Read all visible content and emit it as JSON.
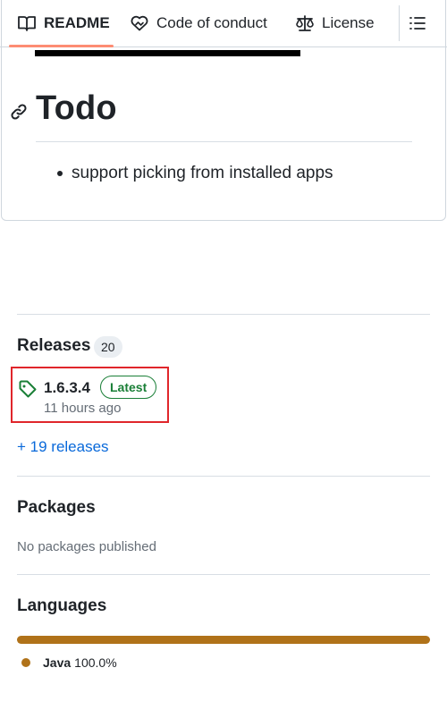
{
  "tabs": {
    "readme": "README",
    "conduct": "Code of conduct",
    "license": "License"
  },
  "readme": {
    "heading": "Todo",
    "items": [
      "support picking from installed apps"
    ]
  },
  "releases": {
    "title": "Releases",
    "count": "20",
    "latest": {
      "version": "1.6.3.4",
      "badge": "Latest",
      "time": "11 hours ago"
    },
    "more_link": "+ 19 releases"
  },
  "packages": {
    "title": "Packages",
    "empty_text": "No packages published"
  },
  "languages": {
    "title": "Languages",
    "items": [
      {
        "name": "Java",
        "percent": "100.0%",
        "color": "#b07219"
      }
    ]
  },
  "colors": {
    "accent_underline": "#fd8c73",
    "link": "#0969da",
    "success": "#1a7f37",
    "highlight_box": "#e0262b"
  },
  "icons": [
    "book-icon",
    "code-of-conduct-heart-icon",
    "law-scale-icon",
    "list-outline-icon",
    "link-icon",
    "tag-icon"
  ]
}
